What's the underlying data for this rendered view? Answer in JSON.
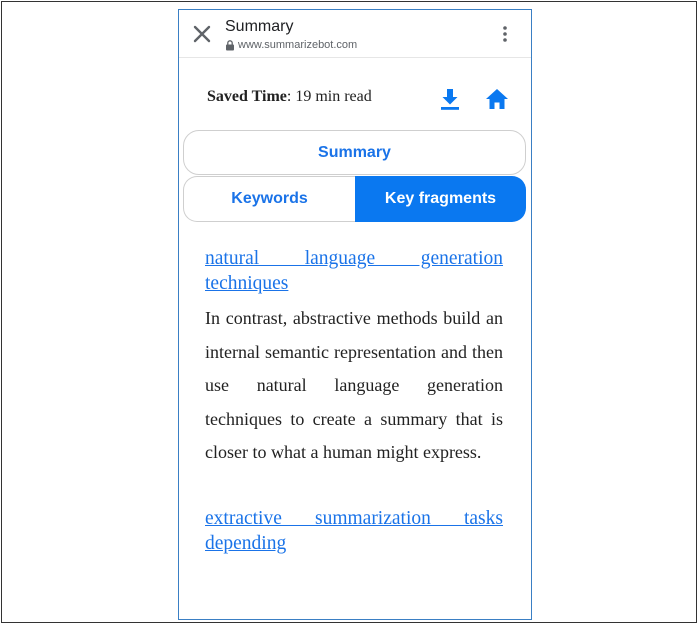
{
  "browser": {
    "title": "Summary",
    "url": "www.summarizebot.com"
  },
  "stats": {
    "saved_label": "Saved Time",
    "saved_value": ": 19 min read"
  },
  "tabs": {
    "summary": "Summary",
    "keywords": "Keywords",
    "fragments": "Key fragments",
    "active": "fragments"
  },
  "fragments": [
    {
      "title": "natural language generation techniques",
      "text": "In contrast, abstractive methods build an internal semantic representation and then use natural language generation techniques to create a summary that is closer to what a human might express."
    },
    {
      "title": "extractive summarization tasks depending"
    }
  ],
  "colors": {
    "accent": "#1a73e8",
    "active_tab": "#0a78f0"
  },
  "icons": {
    "close": "close-icon",
    "lock": "lock-icon",
    "menu": "more-vert-icon",
    "download": "download-icon",
    "home": "home-icon"
  }
}
